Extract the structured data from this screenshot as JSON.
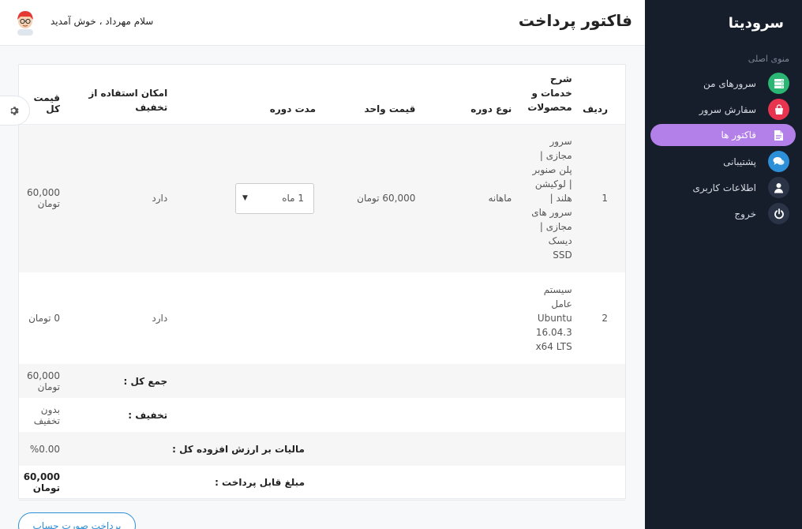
{
  "sidebar": {
    "brand": "سرودیتا",
    "menu_caption": "منوی اصلی",
    "items": [
      {
        "label": "سرورهای من",
        "icon": "server-icon",
        "color": "#2bb673"
      },
      {
        "label": "سفارش سرور",
        "icon": "shopping-bag-icon",
        "color": "#e8344e"
      },
      {
        "label": "فاکتور ها",
        "icon": "document-icon",
        "color": "#b37fe8"
      },
      {
        "label": "پشتیبانی",
        "icon": "chat-icon",
        "color": "#2d8fd8"
      },
      {
        "label": "اطلاعات کاربری",
        "icon": "user-icon",
        "color": "#2a3446"
      },
      {
        "label": "خروج",
        "icon": "power-icon",
        "color": "#2a3446"
      }
    ]
  },
  "header": {
    "title": "فاکتور پرداخت",
    "greeting": "سلام مهرداد ، خوش آمدید"
  },
  "table": {
    "headers": {
      "index": "ردیف",
      "description": "شرح خدمات و محصولات",
      "period_type": "نوع دوره",
      "unit_price": "قیمت واحد",
      "duration": "مدت دوره",
      "discount": "امکان استفاده از تخفیف",
      "total": "قیمت کل"
    },
    "rows": [
      {
        "index": "1",
        "description": "سرور مجازی | پلن صنوبر | لوکیشن هلند | سرور های مجازی | دیسک SSD",
        "period_type": "ماهانه",
        "unit_price": "60,000 تومان",
        "duration": "1 ماه",
        "discount": "دارد",
        "total": "60,000 تومان"
      },
      {
        "index": "2",
        "description": "سیستم عامل Ubuntu 16.04.3 x64 LTS",
        "period_type": "",
        "unit_price": "",
        "duration": "",
        "discount": "دارد",
        "total": "0 تومان"
      }
    ],
    "summary": [
      {
        "label": "جمع کل :",
        "value": "60,000 تومان"
      },
      {
        "label": "تخفیف :",
        "value": "بدون تخفیف"
      },
      {
        "label": "مالیات بر ارزش افزوده کل :",
        "value": "%0.00"
      },
      {
        "label": "مبلغ قابل پرداخت :",
        "value": "60,000 تومان"
      }
    ]
  },
  "actions": {
    "pay_button": "پرداخت صورت حساب"
  }
}
